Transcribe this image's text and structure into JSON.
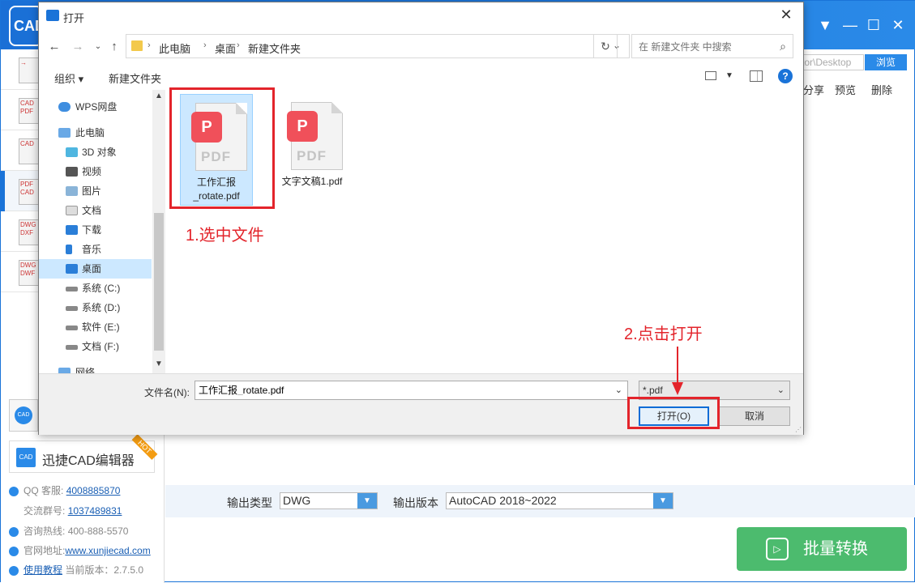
{
  "app": {
    "logo": "CAD",
    "minimize": "—",
    "maximize": "☐",
    "close": "✕",
    "menu": "▼",
    "path_value": "tor\\Desktop",
    "browse_label": "浏览",
    "list_actions": [
      "分享",
      "预览",
      "删除"
    ],
    "sidebar_icons": [
      {
        "label": "→"
      },
      {
        "label": "CAD PDF"
      },
      {
        "label": "CAD"
      },
      {
        "label": "PDF CAD"
      },
      {
        "label": "DWG DXF"
      },
      {
        "label": "DWG DWF"
      }
    ],
    "qq_icon_label": "CAD",
    "editor_icon": "CAD",
    "editor_label": "迅捷CAD编辑器",
    "hot_badge": "HOT",
    "info": [
      {
        "label": "QQ 客服:",
        "value": "4008885870",
        "link": true
      },
      {
        "label": "交流群号:",
        "value": "1037489831",
        "link": true
      },
      {
        "label": "咨询热线:",
        "value": "400-888-5570",
        "link": false
      },
      {
        "label": "官网地址:",
        "value": "www.xunjiecad.com",
        "link": true
      },
      {
        "label": "使用教程",
        "value": "当前版本：2.7.5.0",
        "link": false
      }
    ],
    "output_type_label": "输出类型",
    "output_type_value": "DWG",
    "output_version_label": "输出版本",
    "output_version_value": "AutoCAD 2018~2022",
    "convert_label": "批量转换",
    "accent_color": "#1a73d8",
    "convert_color": "#4cbb6e"
  },
  "dialog": {
    "title": "打开",
    "close": "✕",
    "breadcrumbs": [
      "此电脑",
      "桌面",
      "新建文件夹"
    ],
    "search_placeholder": "在 新建文件夹 中搜索",
    "toolbar": {
      "organize": "组织 ▾",
      "new_folder": "新建文件夹",
      "help": "?"
    },
    "nav_items": [
      {
        "label": "WPS网盘",
        "icon": "cloud-icon"
      },
      {
        "label": "此电脑",
        "icon": "computer-icon"
      },
      {
        "label": "3D 对象",
        "icon": "cube-icon"
      },
      {
        "label": "视频",
        "icon": "video-icon"
      },
      {
        "label": "图片",
        "icon": "picture-icon"
      },
      {
        "label": "文档",
        "icon": "document-icon"
      },
      {
        "label": "下载",
        "icon": "download-icon"
      },
      {
        "label": "音乐",
        "icon": "music-icon"
      },
      {
        "label": "桌面",
        "icon": "desktop-icon",
        "selected": true
      },
      {
        "label": "系统 (C:)",
        "icon": "drive-icon"
      },
      {
        "label": "系统 (D:)",
        "icon": "drive-icon"
      },
      {
        "label": "软件 (E:)",
        "icon": "drive-icon"
      },
      {
        "label": "文档 (F:)",
        "icon": "drive-icon"
      },
      {
        "label": "网络",
        "icon": "network-icon"
      }
    ],
    "files": [
      {
        "name": "工作汇报_rotate.pdf",
        "name_line1": "工作汇报",
        "name_line2": "_rotate.pdf",
        "selected": true,
        "badge": "P",
        "ext": "PDF"
      },
      {
        "name": "文字文稿1.pdf",
        "name_line1": "文字文稿1.pdf",
        "name_line2": "",
        "selected": false,
        "badge": "P",
        "ext": "PDF"
      }
    ],
    "filename_label": "文件名(N):",
    "filename_value": "工作汇报_rotate.pdf",
    "filetype_value": "*.pdf",
    "open_label": "打开(O)",
    "cancel_label": "取消"
  },
  "annotations": {
    "step1": "1.选中文件",
    "step2": "2.点击打开",
    "color": "#e3242b"
  }
}
